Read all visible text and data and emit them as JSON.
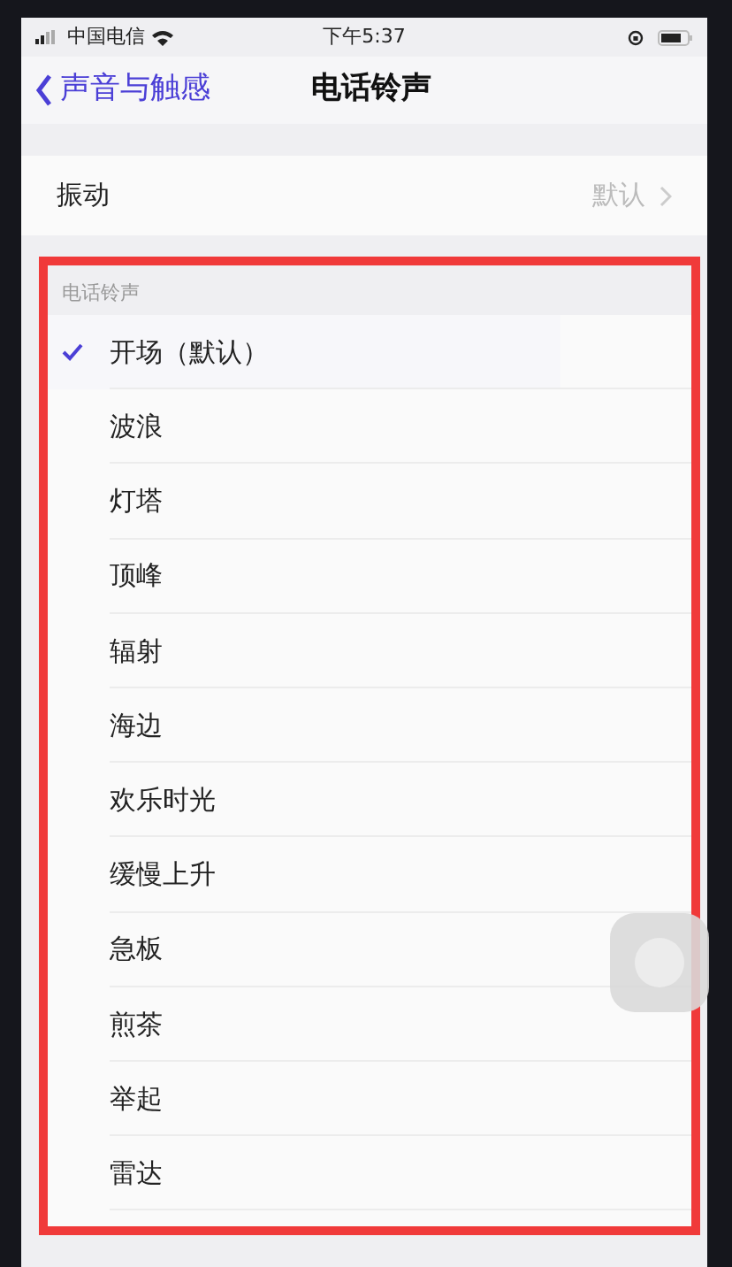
{
  "status_bar": {
    "carrier": "中国电信",
    "time": "下午5:37"
  },
  "nav": {
    "back": "声音与触感",
    "title": "电话铃声"
  },
  "vibration": {
    "label": "振动",
    "value": "默认"
  },
  "ringtones": {
    "header": "电话铃声",
    "items": [
      {
        "label": "开场（默认）",
        "selected": true
      },
      {
        "label": "波浪",
        "selected": false
      },
      {
        "label": "灯塔",
        "selected": false
      },
      {
        "label": "顶峰",
        "selected": false
      },
      {
        "label": "辐射",
        "selected": false
      },
      {
        "label": "海边",
        "selected": false
      },
      {
        "label": "欢乐时光",
        "selected": false
      },
      {
        "label": "缓慢上升",
        "selected": false
      },
      {
        "label": "急板",
        "selected": false
      },
      {
        "label": "煎茶",
        "selected": false
      },
      {
        "label": "举起",
        "selected": false
      },
      {
        "label": "雷达",
        "selected": false
      }
    ]
  }
}
